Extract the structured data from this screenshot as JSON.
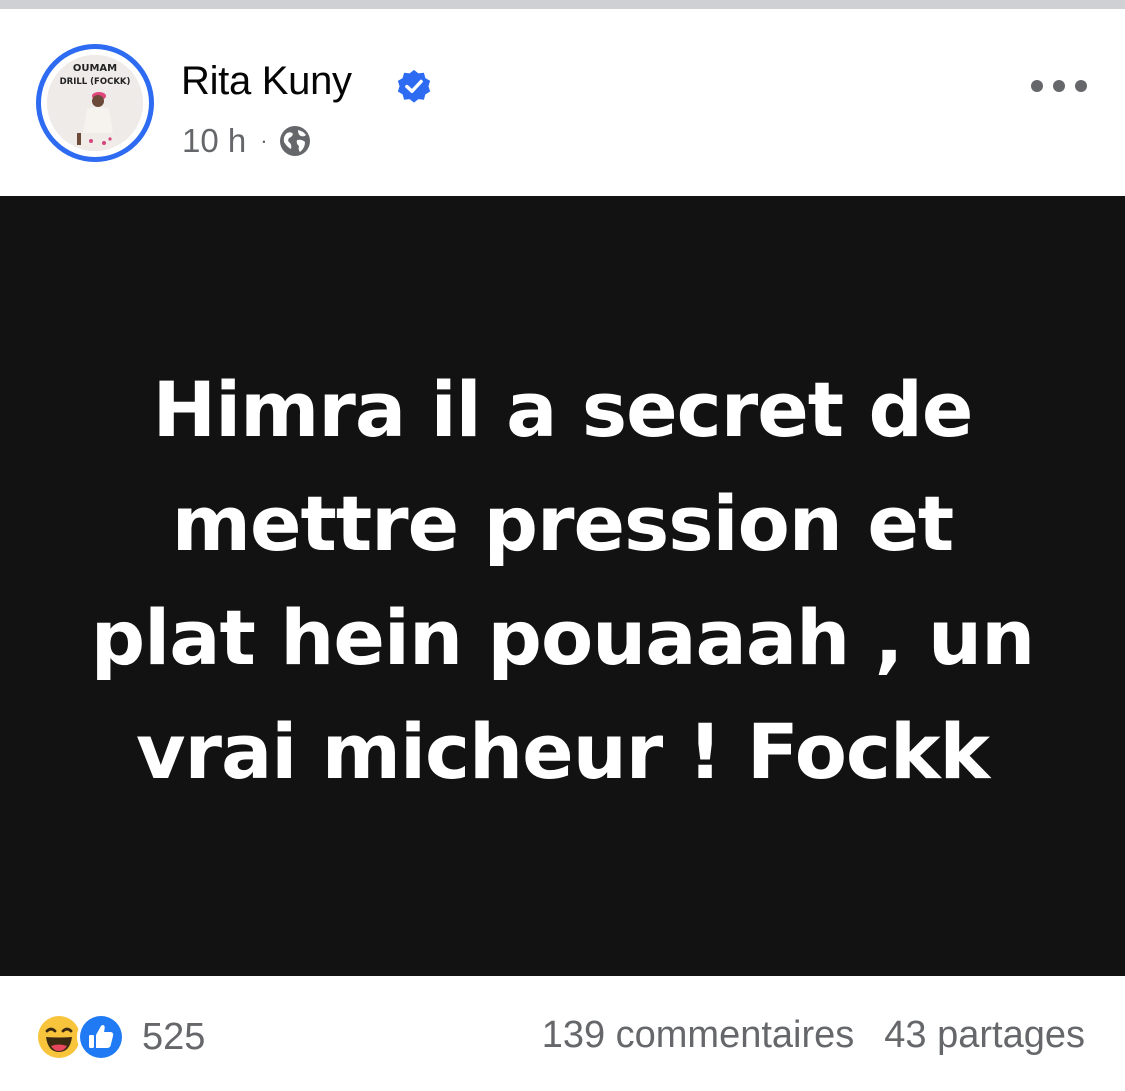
{
  "post": {
    "author": {
      "name": "Rita Kuny",
      "verified": true,
      "avatar_caption_line1": "OUMAM",
      "avatar_caption_line2": "DRILL (FOCKK)"
    },
    "time": "10 h",
    "separator": "·",
    "audience_icon": "globe-icon",
    "more_icon": "more-options-icon",
    "text_lines": [
      "Himra il a secret de",
      "mettre pression et",
      "plat hein pouaaah , un",
      "vrai micheur ! Fockk"
    ],
    "background_color": "#121212"
  },
  "footer": {
    "reaction_icons": [
      "haha-icon",
      "like-icon"
    ],
    "reaction_count": "525",
    "comments": "139 commentaires",
    "shares": "43 partages"
  },
  "colors": {
    "accent": "#2d6bf2",
    "secondary_text": "#65676b",
    "primary_text": "#050505"
  }
}
